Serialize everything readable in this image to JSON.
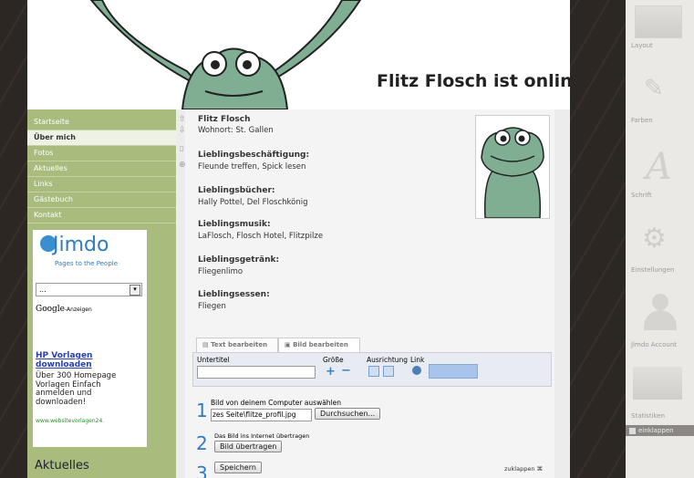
{
  "site": {
    "title": "Flitz Flosch ist online"
  },
  "nav": {
    "items": [
      {
        "label": "Startseite"
      },
      {
        "label": "Über mich"
      },
      {
        "label": "Fotos"
      },
      {
        "label": "Aktuelles"
      },
      {
        "label": "Links"
      },
      {
        "label": "Gästebuch"
      },
      {
        "label": "Kontakt"
      }
    ]
  },
  "ad": {
    "brand": "Jimdo",
    "tagline": "Pages to the People",
    "select_value": "...",
    "google_label": "Google",
    "anzeigen": "-Anzeigen",
    "link_title": "HP Vorlagen downloaden",
    "body": "Über 300 Homepage Vorlagen Einfach anmelden und downloaden!",
    "url": "www.websitevorlagen24."
  },
  "sidebar": {
    "aktuelles": "Aktuelles"
  },
  "profile": {
    "name": "Flitz Flosch",
    "wohnort": "Wohnort: St. Gallen",
    "fields": [
      {
        "label": "Lieblingsbeschäftigung:",
        "value": "Fleunde treffen, Spick lesen"
      },
      {
        "label": "Lieblingsbücher:",
        "value": "Hally Pottel, Del Floschkönig"
      },
      {
        "label": "Lieblingsmusik:",
        "value": "LaFlosch, Flosch Hotel, Flitzpilze"
      },
      {
        "label": "Lieblingsgetränk:",
        "value": "Fliegenlimo"
      },
      {
        "label": "Lieblingsessen:",
        "value": "Fliegen"
      }
    ]
  },
  "editor": {
    "tab_text": "Text bearbeiten",
    "tab_bild": "Bild bearbeiten",
    "untertitel": "Untertitel",
    "groesse": "Größe",
    "ausrichtung": "Ausrichtung",
    "link": "Link",
    "step1_num": "1",
    "step1_label": "Bild von deinem Computer auswählen",
    "file_value": "zes Seite\\flitze_profil.jpg",
    "browse_label": "Durchsuchen...",
    "step2_num": "2",
    "step2_label": "Das Bild ins Internet übertragen",
    "upload_label": "Bild übertragen",
    "step3_num": "3",
    "save_label": "Speichern",
    "collapse_label": "zuklappen"
  },
  "panel": {
    "layout": "Layout",
    "farben": "Farben",
    "schrift": "Schrift",
    "einstellungen": "Einstellungen",
    "account": "Jimdo Account",
    "statistiken": "Statistiken",
    "einklappen": "einklappen"
  },
  "colors": {
    "sidebar": "#a7bc7d",
    "frog": "#7fae93",
    "dark_bg": "#2d2724",
    "link_blue": "#2a3fb0"
  }
}
